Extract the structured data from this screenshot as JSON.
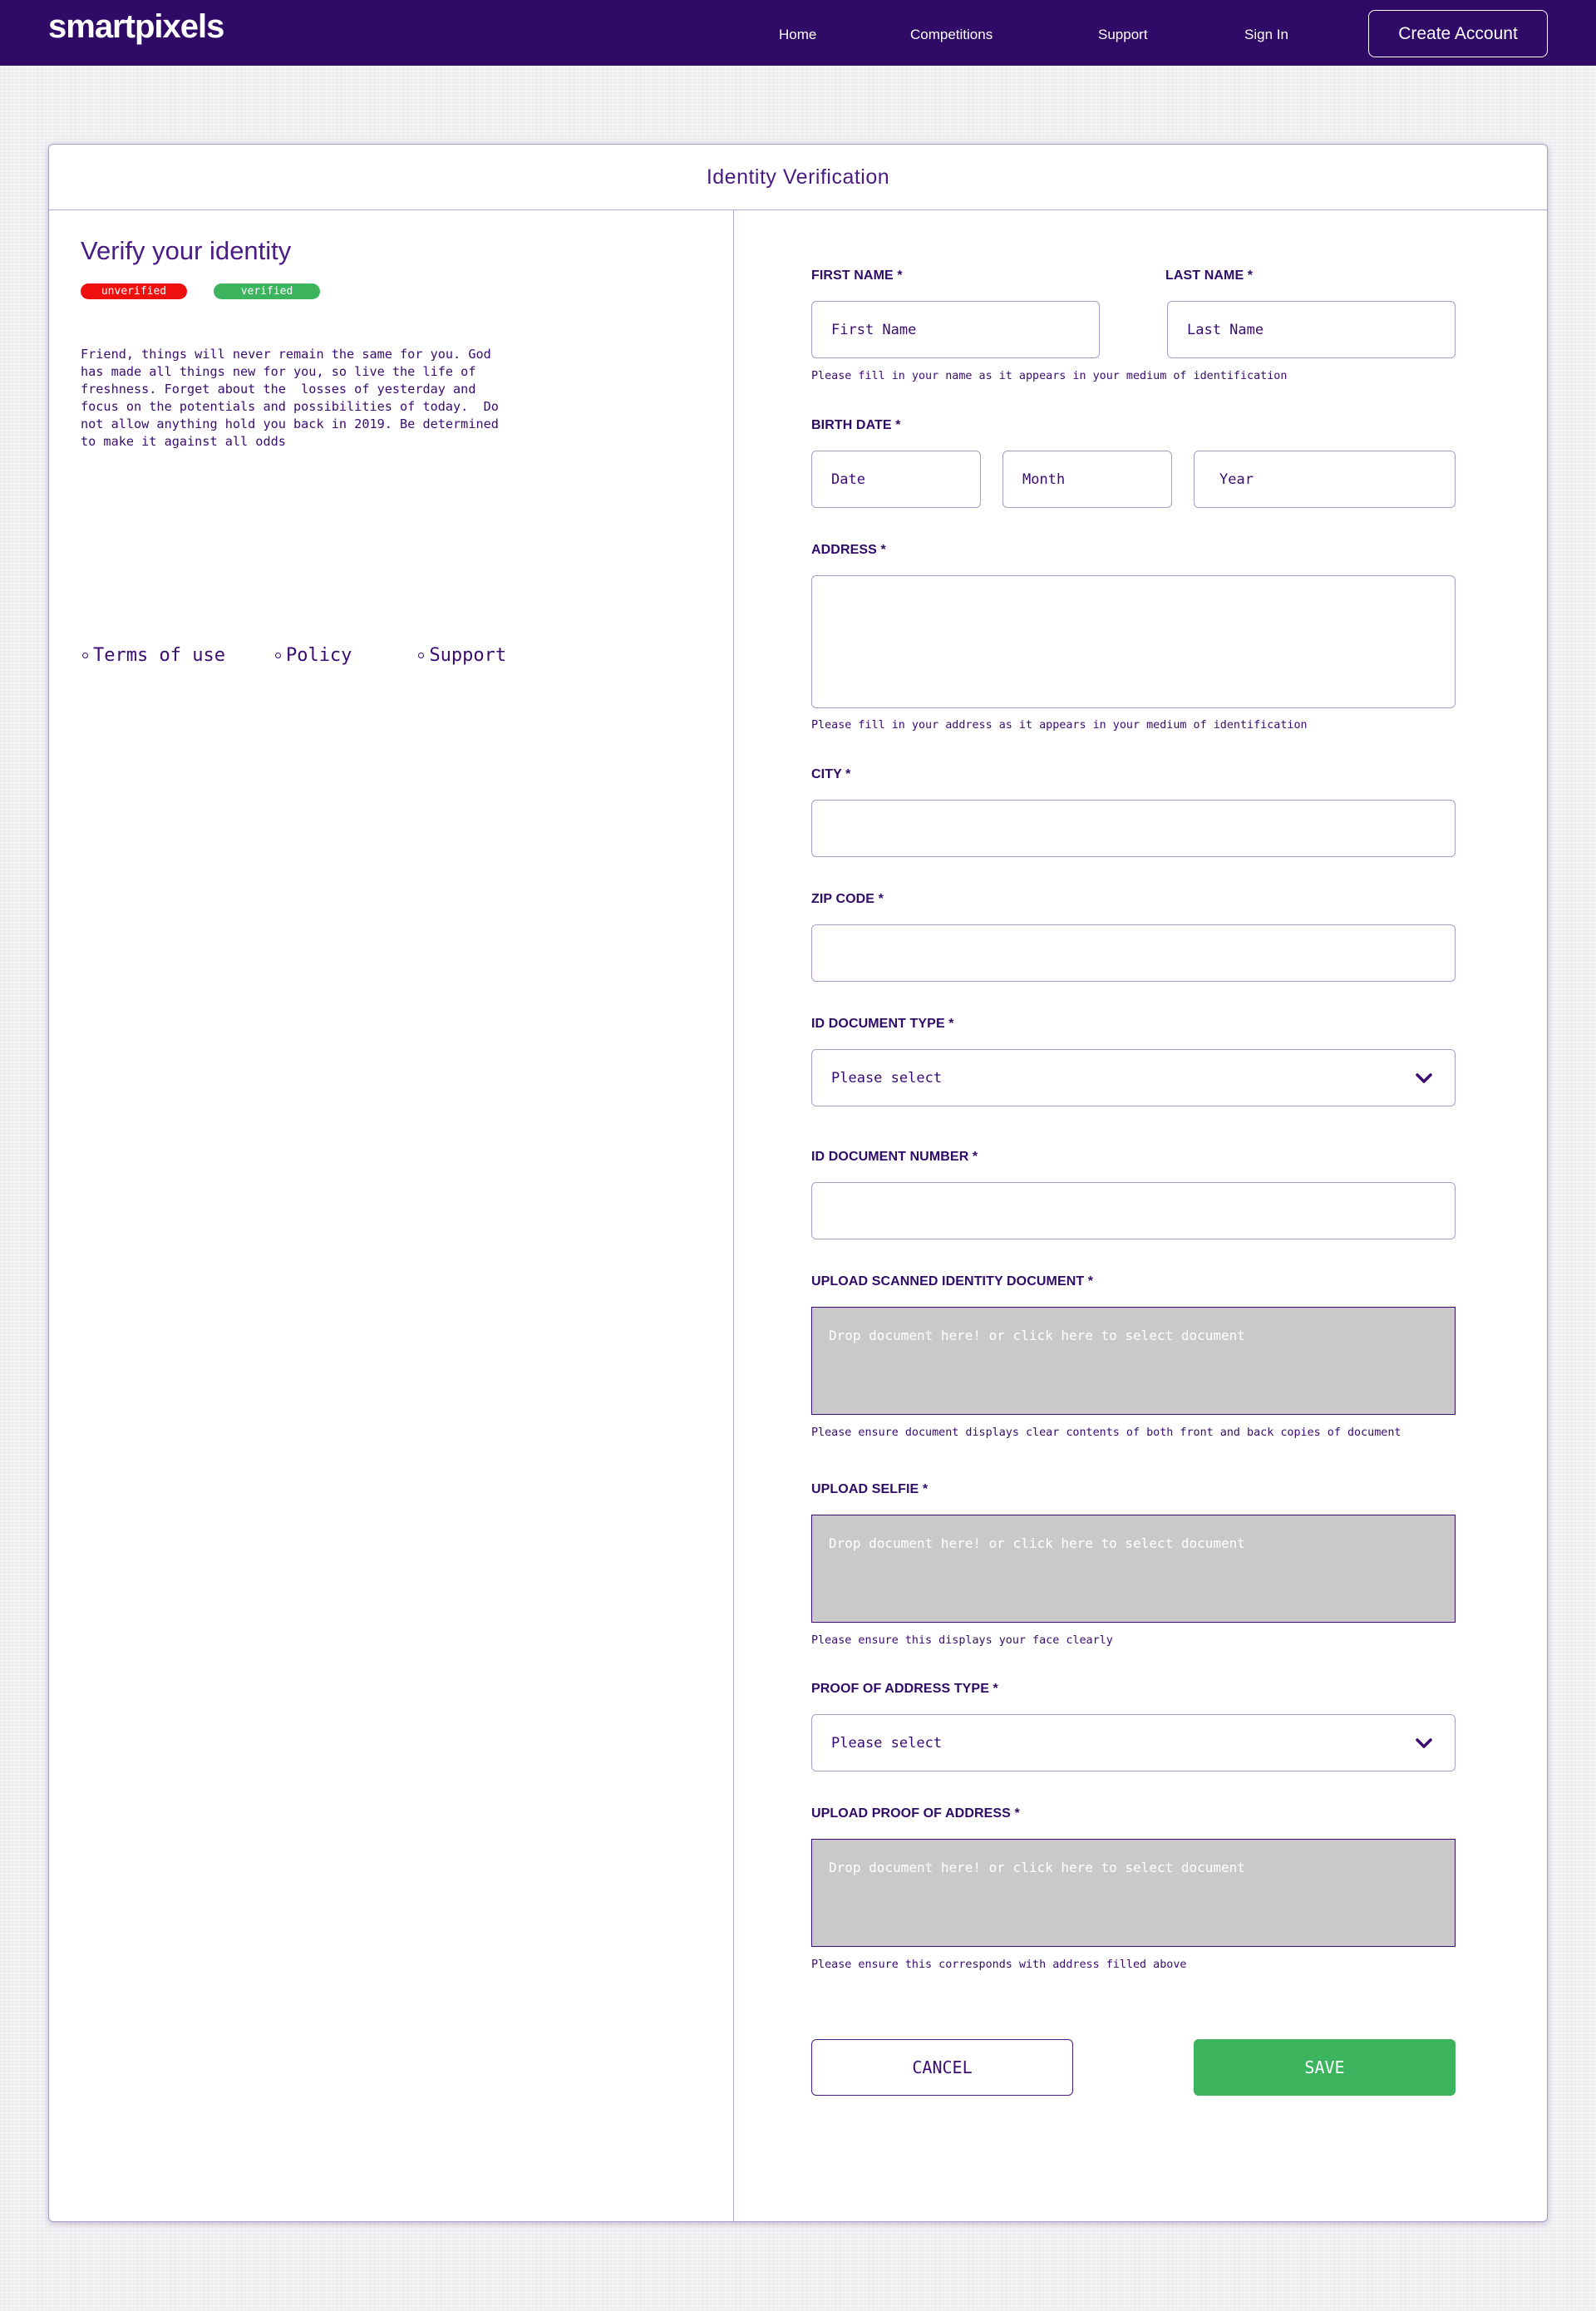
{
  "nav": {
    "logo": "smartpixels",
    "links": [
      "Home",
      "Competitions",
      "Support",
      "Sign In"
    ],
    "create_account": "Create Account"
  },
  "card": {
    "title": "Identity Verification"
  },
  "left": {
    "title": "Verify your identity",
    "badges": [
      "unverified",
      "verified"
    ],
    "badge_colors": {
      "unverified": "#ef0f0f",
      "verified": "#3cb35d"
    },
    "intro": "Friend, things will never remain the same for you. God\nhas made all things new for you, so live the life of\nfreshness. Forget about the  losses of yesterday and\nfocus on the potentials and possibilities of today.  Do\nnot allow anything hold you back in 2019. Be determined\nto make it against all odds",
    "footer_links": [
      "Terms of use",
      "Policy",
      "Support"
    ]
  },
  "form": {
    "first_name": {
      "label": "FIRST NAME *",
      "placeholder": "First Name",
      "value": ""
    },
    "last_name": {
      "label": "LAST NAME *",
      "placeholder": "Last Name",
      "value": ""
    },
    "name_hint": "Please fill in your name as it appears in your medium of identification",
    "birth_date": {
      "label": "BIRTH DATE *",
      "date_placeholder": "Date",
      "month_placeholder": "Month",
      "year_placeholder": "Year"
    },
    "address": {
      "label": "ADDRESS *",
      "value": "",
      "hint": "Please fill in your address as it appears in your medium of identification"
    },
    "city": {
      "label": "CITY *",
      "value": ""
    },
    "zip_code": {
      "label": "ZIP CODE *",
      "value": ""
    },
    "id_document_type": {
      "label": "ID DOCUMENT TYPE *",
      "selected": "Please select"
    },
    "id_document_number": {
      "label": "ID DOCUMENT NUMBER *",
      "value": ""
    },
    "upload_identity": {
      "label": "UPLOAD SCANNED IDENTITY DOCUMENT *",
      "drop_text": "Drop document here! or click here to select document",
      "hint": "Please ensure document displays clear contents of both front and back copies of document"
    },
    "upload_selfie": {
      "label": "UPLOAD SELFIE *",
      "drop_text": "Drop document here! or click here to select document",
      "hint": "Please ensure this displays your face clearly"
    },
    "proof_of_address_type": {
      "label": "PROOF OF ADDRESS TYPE *",
      "selected": "Please select"
    },
    "upload_proof_of_address": {
      "label": "UPLOAD PROOF OF ADDRESS *",
      "drop_text": "Drop document here! or click here to select document",
      "hint": "Please ensure this corresponds with address filled above"
    },
    "cancel_label": "CANCEL",
    "save_label": "SAVE"
  },
  "colors": {
    "brand": "#2f0a67",
    "text": "#3a0b70",
    "border": "#a99cc6",
    "save": "#3cb35d",
    "unverified": "#ef0f0f",
    "dropzone": "#c9c9c9"
  },
  "icons": {
    "select_chevron": "chevron-down-icon",
    "footer_bullet": "circle-bullet-icon"
  }
}
